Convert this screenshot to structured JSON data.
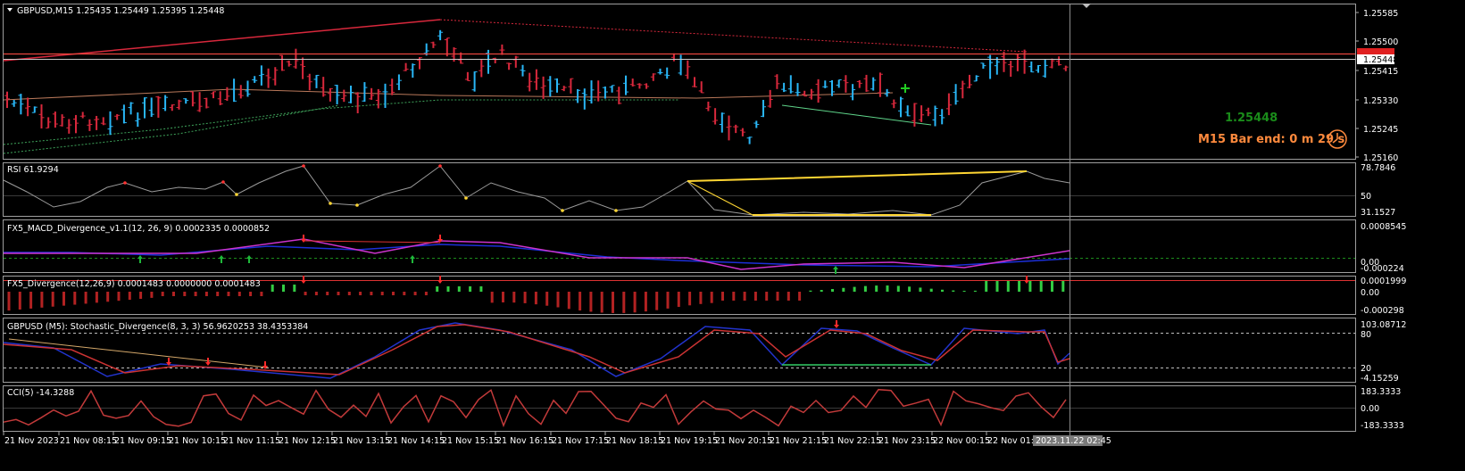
{
  "symbol_header": "GBPUSD,M15  1.25435 1.25449 1.25395 1.25448",
  "bid_big": "1.25448",
  "bar_end": "M15 Bar end: 0 m 29 s",
  "price_axis": [
    "1.25585",
    "1.25500",
    "1.25448",
    "1.25415",
    "1.25330",
    "1.25245",
    "1.25160"
  ],
  "rsi": {
    "header": "RSI 61.9294",
    "levels": [
      "78.7846",
      "50",
      "31.1527"
    ]
  },
  "macd": {
    "header": "FX5_MACD_Divergence_v1.1(12, 26, 9) 0.0002335 0.0000852",
    "levels": [
      "0.0008545",
      "0.00",
      "-0.000224"
    ]
  },
  "fx5div": {
    "header": "FX5_Divergence(12,26,9) 0.0001483 0.0000000 0.0001483",
    "levels": [
      "0.0001999",
      "0.00",
      "-0.000298"
    ]
  },
  "stoch": {
    "header": "GBPUSD (M5):  Stochastic_Divergence(8, 3, 3) 56.9620253 38.4353384",
    "levels": [
      "103.08712",
      "80",
      "20",
      "-4.15259"
    ]
  },
  "cci": {
    "header": "CCI(5) -14.3288",
    "levels": [
      "183.3333",
      "0.00",
      "-183.3333"
    ]
  },
  "time_axis": [
    "21 Nov 2023",
    "21 Nov 08:15",
    "21 Nov 09:15",
    "21 Nov 10:15",
    "21 Nov 11:15",
    "21 Nov 12:15",
    "21 Nov 13:15",
    "21 Nov 14:15",
    "21 Nov 15:15",
    "21 Nov 16:15",
    "21 Nov 17:15",
    "21 Nov 18:15",
    "21 Nov 19:15",
    "21 Nov 20:15",
    "21 Nov 21:15",
    "21 Nov 22:15",
    "21 Nov 23:15",
    "22 Nov 00:15",
    "22 Nov 01:15"
  ],
  "crosshair_time": "2023.11.22 02:45",
  "colors": {
    "bull": "#29b6f6",
    "bear": "#d8283c",
    "rsi_line": "#9a9a9a",
    "highlight": "#ffd633",
    "macd_blue": "#1c2fd8",
    "macd_magenta": "#cc33cc",
    "arrow_green": "#1fb83a",
    "arrow_red": "#ff2b2b",
    "stoch_blue": "#2233cc",
    "stoch_red": "#cc3333",
    "cci_line": "#c23a3a",
    "text": "#ffffff",
    "bid_box": "#ffffff",
    "bar_end": "#ff8a3d",
    "bid_green": "#1a8c1a"
  }
}
